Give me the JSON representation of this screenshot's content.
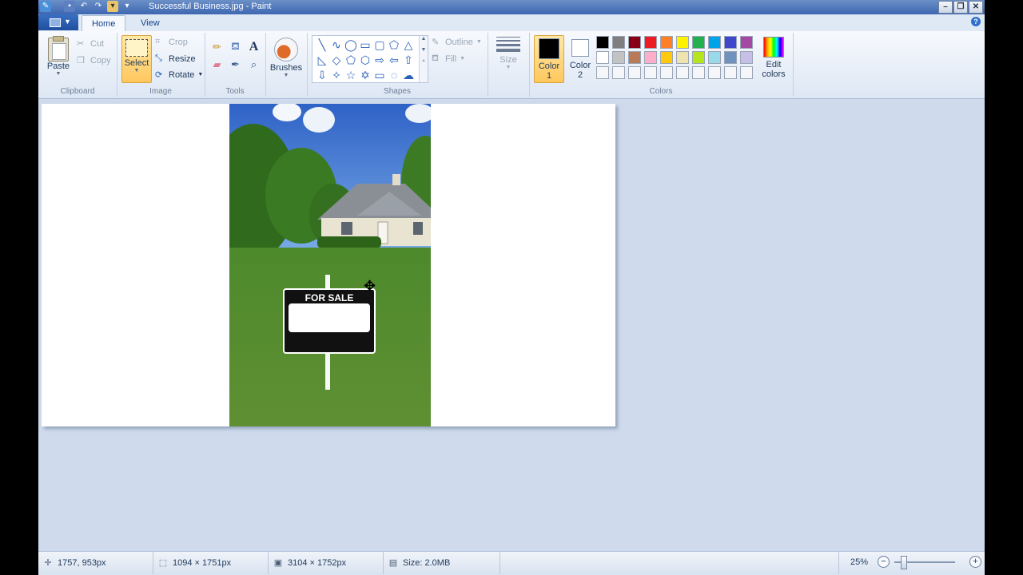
{
  "window": {
    "title": "Successful Business.jpg - Paint"
  },
  "tabs": [
    {
      "label": "Home"
    },
    {
      "label": "View"
    }
  ],
  "clipboard": {
    "group_label": "Clipboard",
    "paste": "Paste",
    "cut": "Cut",
    "copy": "Copy"
  },
  "image": {
    "group_label": "Image",
    "select": "Select",
    "crop": "Crop",
    "resize": "Resize",
    "rotate": "Rotate"
  },
  "tools": {
    "group_label": "Tools"
  },
  "brushes": {
    "label": "Brushes"
  },
  "shapes": {
    "group_label": "Shapes",
    "outline": "Outline",
    "fill": "Fill"
  },
  "size": {
    "label": "Size"
  },
  "colors": {
    "group_label": "Colors",
    "color1_label": "Color 1",
    "color2_label": "Color 2",
    "edit_label": "Edit colors",
    "color1": "#000000",
    "color2": "#ffffff",
    "palette_row1": [
      "#000000",
      "#7f7f7f",
      "#880015",
      "#ed1c24",
      "#ff7f27",
      "#fff200",
      "#22b14c",
      "#00a2e8",
      "#3f48cc",
      "#a349a4"
    ],
    "palette_row2": [
      "#ffffff",
      "#c3c3c3",
      "#b97a57",
      "#ffaec9",
      "#ffc90e",
      "#efe4b0",
      "#b5e61d",
      "#99d9ea",
      "#7092be",
      "#c8bfe7"
    ],
    "palette_row3": [
      "#f4f6fa",
      "#f4f6fa",
      "#f4f6fa",
      "#f4f6fa",
      "#f4f6fa",
      "#f4f6fa",
      "#f4f6fa",
      "#f4f6fa",
      "#f4f6fa",
      "#f4f6fa"
    ]
  },
  "photo": {
    "sign_text": "FOR SALE"
  },
  "status": {
    "cursor_pos": "1757, 953px",
    "selection_size": "1094 × 1751px",
    "image_size": "3104 × 1752px",
    "file_size": "Size: 2.0MB",
    "zoom": "25%"
  }
}
